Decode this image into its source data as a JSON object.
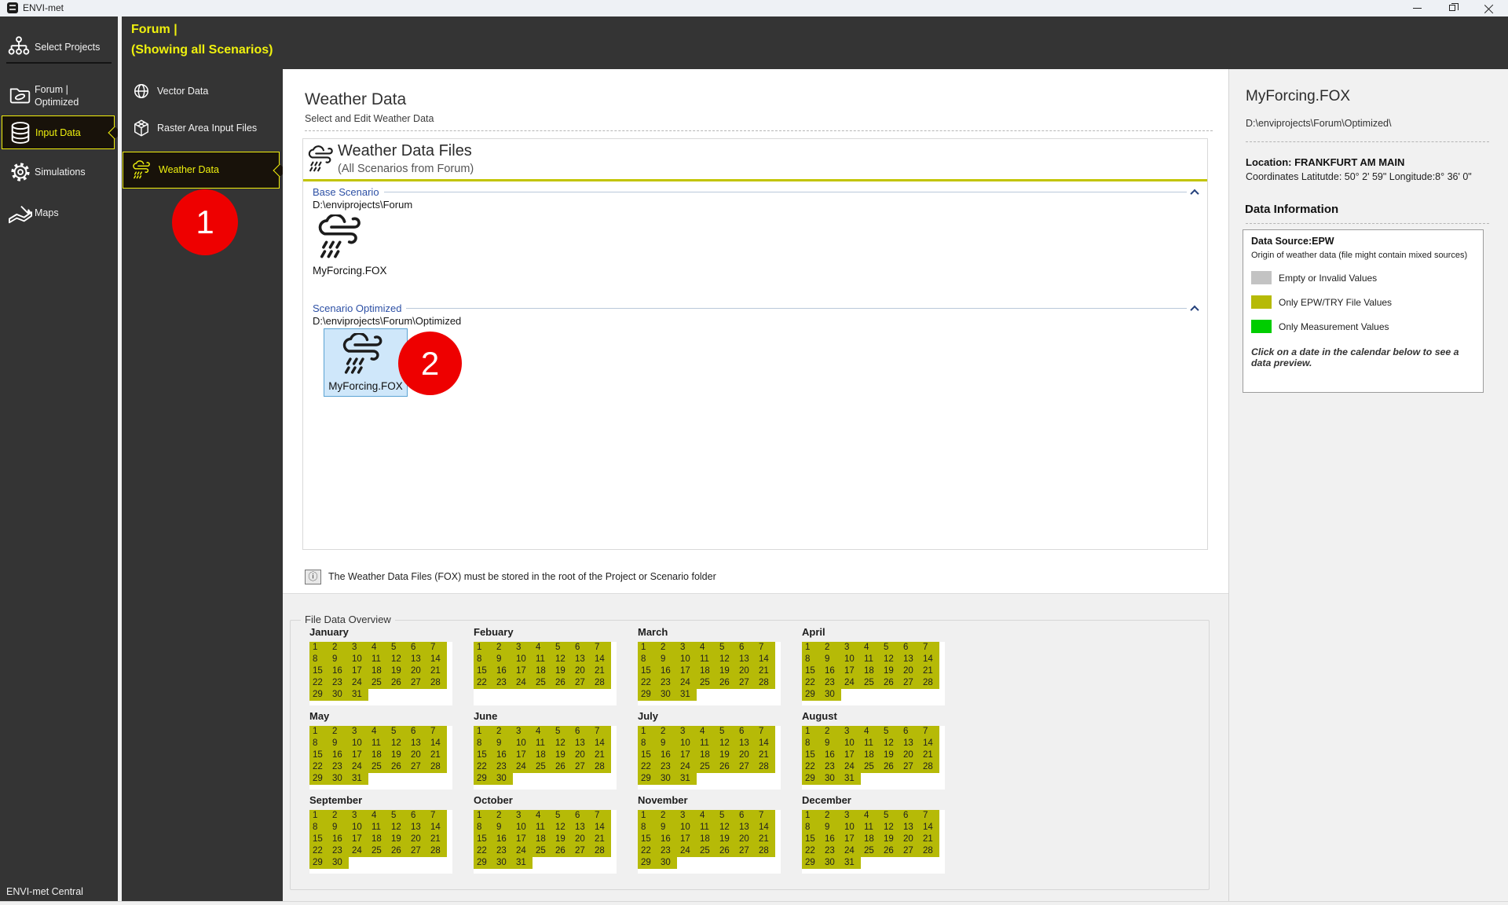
{
  "colors": {
    "accent_yellow": "#eff10e",
    "selection_border_yellow": "#f2ef0c",
    "panel_rule_yellow": "#c2c400",
    "badge_red": "#ee0000",
    "section_label_blue": "#2d50a5",
    "selected_tile_bg": "#cfe7fa",
    "selected_tile_border": "#5ba3d3",
    "sidebar_dark": "#343434"
  },
  "titlebar": {
    "app_title": "ENVI-met"
  },
  "left_sidebar": {
    "select_projects": "Select Projects",
    "project_line1": "Forum |",
    "project_line2": "Optimized",
    "input_data": "Input Data",
    "simulations": "Simulations",
    "maps": "Maps",
    "footer": "ENVI-met Central"
  },
  "header": {
    "line1": "Forum |",
    "line2": "(Showing all Scenarios)"
  },
  "nav_sidebar": {
    "vector": "Vector Data",
    "raster": "Raster Area Input Files",
    "weather": "Weather Data"
  },
  "badges": {
    "one": "1",
    "two": "2"
  },
  "main": {
    "title": "Weather Data",
    "subtitle": "Select and Edit Weather Data",
    "panel": {
      "title": "Weather Data Files",
      "subtitle": "(All Scenarios from Forum)",
      "base": {
        "label": "Base Scenario",
        "path": "D:\\enviprojects\\Forum",
        "file": "MyForcing.FOX"
      },
      "optimized": {
        "label": "Scenario Optimized",
        "path": "D:\\enviprojects\\Forum\\Optimized",
        "file": "MyForcing.FOX"
      }
    },
    "note_icon_glyph": "ⓘ",
    "note": "The Weather Data Files (FOX) must be stored in the root of the Project or Scenario folder"
  },
  "overview": {
    "title": "File Data Overview",
    "highlight_color": "#b6ba07",
    "months": [
      {
        "name": "January",
        "days": 31
      },
      {
        "name": "Febuary",
        "days": 28
      },
      {
        "name": "March",
        "days": 31
      },
      {
        "name": "April",
        "days": 30
      },
      {
        "name": "May",
        "days": 31
      },
      {
        "name": "June",
        "days": 30
      },
      {
        "name": "July",
        "days": 31
      },
      {
        "name": "August",
        "days": 31
      },
      {
        "name": "September",
        "days": 30
      },
      {
        "name": "October",
        "days": 31
      },
      {
        "name": "November",
        "days": 30
      },
      {
        "name": "December",
        "days": 31
      }
    ]
  },
  "details": {
    "title": "MyForcing.FOX",
    "path": "D:\\enviprojects\\Forum\\Optimized\\",
    "location": "Location: FRANKFURT AM MAIN",
    "coordinates": "Coordinates Latitutde: 50° 2' 59\" Longitude:8° 36' 0\"",
    "section_title": "Data Information",
    "data_source": "Data Source:EPW",
    "data_source_note": "Origin of weather data (file might contain mixed sources)",
    "legend": [
      {
        "color": "#c3c3c3",
        "label": "Empty or Invalid Values"
      },
      {
        "color": "#b6ba07",
        "label": "Only EPW/TRY File Values"
      },
      {
        "color": "#00cd00",
        "label": "Only Measurement Values"
      }
    ],
    "hint": "Click on a date in the calendar below to see a data preview."
  }
}
